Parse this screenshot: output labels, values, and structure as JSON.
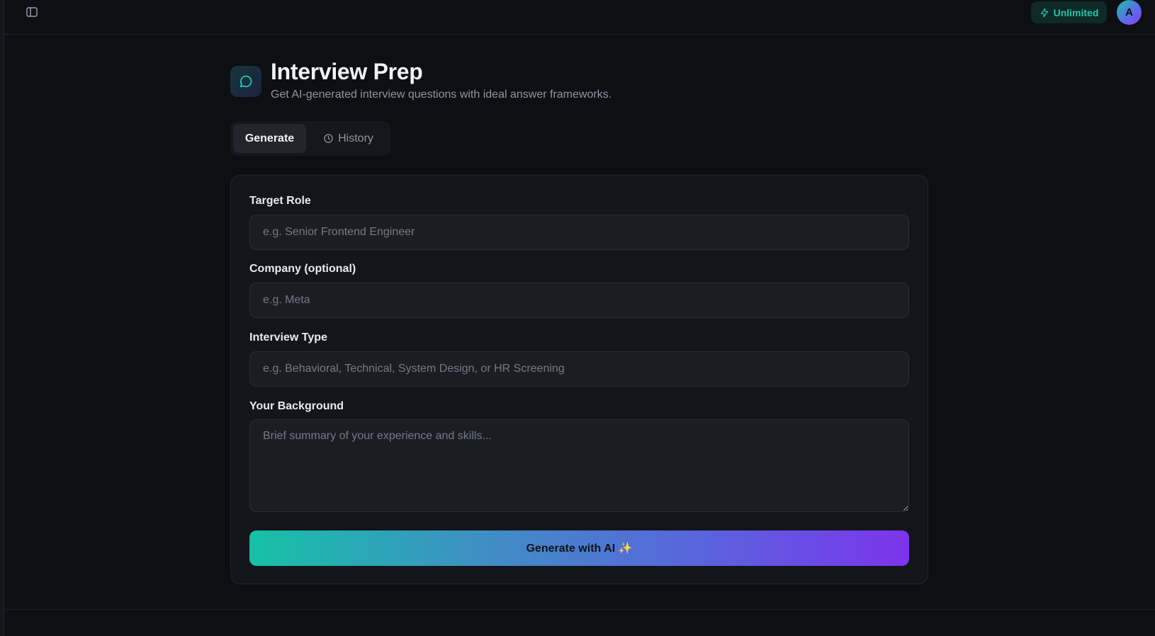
{
  "topbar": {
    "sidebar_toggle_icon": "sidebar-panel-icon",
    "badge": {
      "label": "Unlimited",
      "icon": "lightning-icon",
      "color": "#21c7a8"
    },
    "avatar_initial": "A"
  },
  "header": {
    "icon": "chat-bubble-icon",
    "title": "Interview Prep",
    "subtitle": "Get AI-generated interview questions with ideal answer frameworks."
  },
  "tabs": [
    {
      "label": "Generate",
      "active": true
    },
    {
      "label": "History",
      "icon": "clock-icon",
      "active": false
    }
  ],
  "form": {
    "target_role": {
      "label": "Target Role",
      "placeholder": "e.g. Senior Frontend Engineer",
      "value": ""
    },
    "company": {
      "label": "Company (optional)",
      "placeholder": "e.g. Meta",
      "value": ""
    },
    "interview_type": {
      "label": "Interview Type",
      "placeholder": "e.g. Behavioral, Technical, System Design, or HR Screening",
      "value": ""
    },
    "background": {
      "label": "Your Background",
      "placeholder": "Brief summary of your experience and skills...",
      "value": ""
    },
    "submit_label": "Generate with AI ✨"
  },
  "colors": {
    "background": "#0d0f13",
    "card": "#13151a",
    "accent_teal": "#16c1a6",
    "accent_purple": "#7c34ec"
  }
}
